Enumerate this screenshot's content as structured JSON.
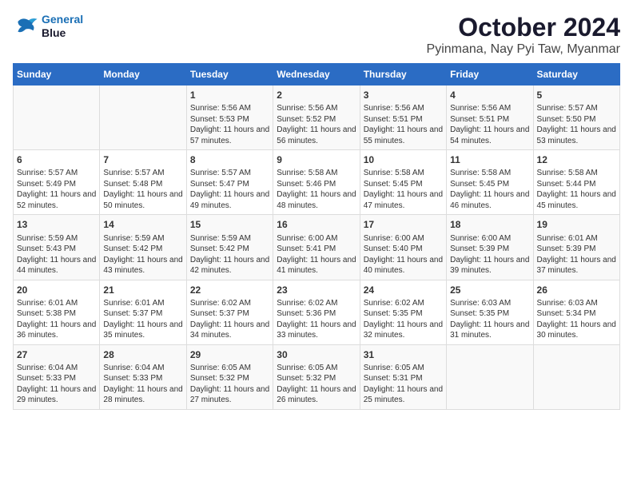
{
  "header": {
    "logo_line1": "General",
    "logo_line2": "Blue",
    "month_title": "October 2024",
    "location": "Pyinmana, Nay Pyi Taw, Myanmar"
  },
  "days_of_week": [
    "Sunday",
    "Monday",
    "Tuesday",
    "Wednesday",
    "Thursday",
    "Friday",
    "Saturday"
  ],
  "weeks": [
    [
      {
        "day": "",
        "info": ""
      },
      {
        "day": "",
        "info": ""
      },
      {
        "day": "1",
        "info": "Sunrise: 5:56 AM\nSunset: 5:53 PM\nDaylight: 11 hours and 57 minutes."
      },
      {
        "day": "2",
        "info": "Sunrise: 5:56 AM\nSunset: 5:52 PM\nDaylight: 11 hours and 56 minutes."
      },
      {
        "day": "3",
        "info": "Sunrise: 5:56 AM\nSunset: 5:51 PM\nDaylight: 11 hours and 55 minutes."
      },
      {
        "day": "4",
        "info": "Sunrise: 5:56 AM\nSunset: 5:51 PM\nDaylight: 11 hours and 54 minutes."
      },
      {
        "day": "5",
        "info": "Sunrise: 5:57 AM\nSunset: 5:50 PM\nDaylight: 11 hours and 53 minutes."
      }
    ],
    [
      {
        "day": "6",
        "info": "Sunrise: 5:57 AM\nSunset: 5:49 PM\nDaylight: 11 hours and 52 minutes."
      },
      {
        "day": "7",
        "info": "Sunrise: 5:57 AM\nSunset: 5:48 PM\nDaylight: 11 hours and 50 minutes."
      },
      {
        "day": "8",
        "info": "Sunrise: 5:57 AM\nSunset: 5:47 PM\nDaylight: 11 hours and 49 minutes."
      },
      {
        "day": "9",
        "info": "Sunrise: 5:58 AM\nSunset: 5:46 PM\nDaylight: 11 hours and 48 minutes."
      },
      {
        "day": "10",
        "info": "Sunrise: 5:58 AM\nSunset: 5:45 PM\nDaylight: 11 hours and 47 minutes."
      },
      {
        "day": "11",
        "info": "Sunrise: 5:58 AM\nSunset: 5:45 PM\nDaylight: 11 hours and 46 minutes."
      },
      {
        "day": "12",
        "info": "Sunrise: 5:58 AM\nSunset: 5:44 PM\nDaylight: 11 hours and 45 minutes."
      }
    ],
    [
      {
        "day": "13",
        "info": "Sunrise: 5:59 AM\nSunset: 5:43 PM\nDaylight: 11 hours and 44 minutes."
      },
      {
        "day": "14",
        "info": "Sunrise: 5:59 AM\nSunset: 5:42 PM\nDaylight: 11 hours and 43 minutes."
      },
      {
        "day": "15",
        "info": "Sunrise: 5:59 AM\nSunset: 5:42 PM\nDaylight: 11 hours and 42 minutes."
      },
      {
        "day": "16",
        "info": "Sunrise: 6:00 AM\nSunset: 5:41 PM\nDaylight: 11 hours and 41 minutes."
      },
      {
        "day": "17",
        "info": "Sunrise: 6:00 AM\nSunset: 5:40 PM\nDaylight: 11 hours and 40 minutes."
      },
      {
        "day": "18",
        "info": "Sunrise: 6:00 AM\nSunset: 5:39 PM\nDaylight: 11 hours and 39 minutes."
      },
      {
        "day": "19",
        "info": "Sunrise: 6:01 AM\nSunset: 5:39 PM\nDaylight: 11 hours and 37 minutes."
      }
    ],
    [
      {
        "day": "20",
        "info": "Sunrise: 6:01 AM\nSunset: 5:38 PM\nDaylight: 11 hours and 36 minutes."
      },
      {
        "day": "21",
        "info": "Sunrise: 6:01 AM\nSunset: 5:37 PM\nDaylight: 11 hours and 35 minutes."
      },
      {
        "day": "22",
        "info": "Sunrise: 6:02 AM\nSunset: 5:37 PM\nDaylight: 11 hours and 34 minutes."
      },
      {
        "day": "23",
        "info": "Sunrise: 6:02 AM\nSunset: 5:36 PM\nDaylight: 11 hours and 33 minutes."
      },
      {
        "day": "24",
        "info": "Sunrise: 6:02 AM\nSunset: 5:35 PM\nDaylight: 11 hours and 32 minutes."
      },
      {
        "day": "25",
        "info": "Sunrise: 6:03 AM\nSunset: 5:35 PM\nDaylight: 11 hours and 31 minutes."
      },
      {
        "day": "26",
        "info": "Sunrise: 6:03 AM\nSunset: 5:34 PM\nDaylight: 11 hours and 30 minutes."
      }
    ],
    [
      {
        "day": "27",
        "info": "Sunrise: 6:04 AM\nSunset: 5:33 PM\nDaylight: 11 hours and 29 minutes."
      },
      {
        "day": "28",
        "info": "Sunrise: 6:04 AM\nSunset: 5:33 PM\nDaylight: 11 hours and 28 minutes."
      },
      {
        "day": "29",
        "info": "Sunrise: 6:05 AM\nSunset: 5:32 PM\nDaylight: 11 hours and 27 minutes."
      },
      {
        "day": "30",
        "info": "Sunrise: 6:05 AM\nSunset: 5:32 PM\nDaylight: 11 hours and 26 minutes."
      },
      {
        "day": "31",
        "info": "Sunrise: 6:05 AM\nSunset: 5:31 PM\nDaylight: 11 hours and 25 minutes."
      },
      {
        "day": "",
        "info": ""
      },
      {
        "day": "",
        "info": ""
      }
    ]
  ]
}
